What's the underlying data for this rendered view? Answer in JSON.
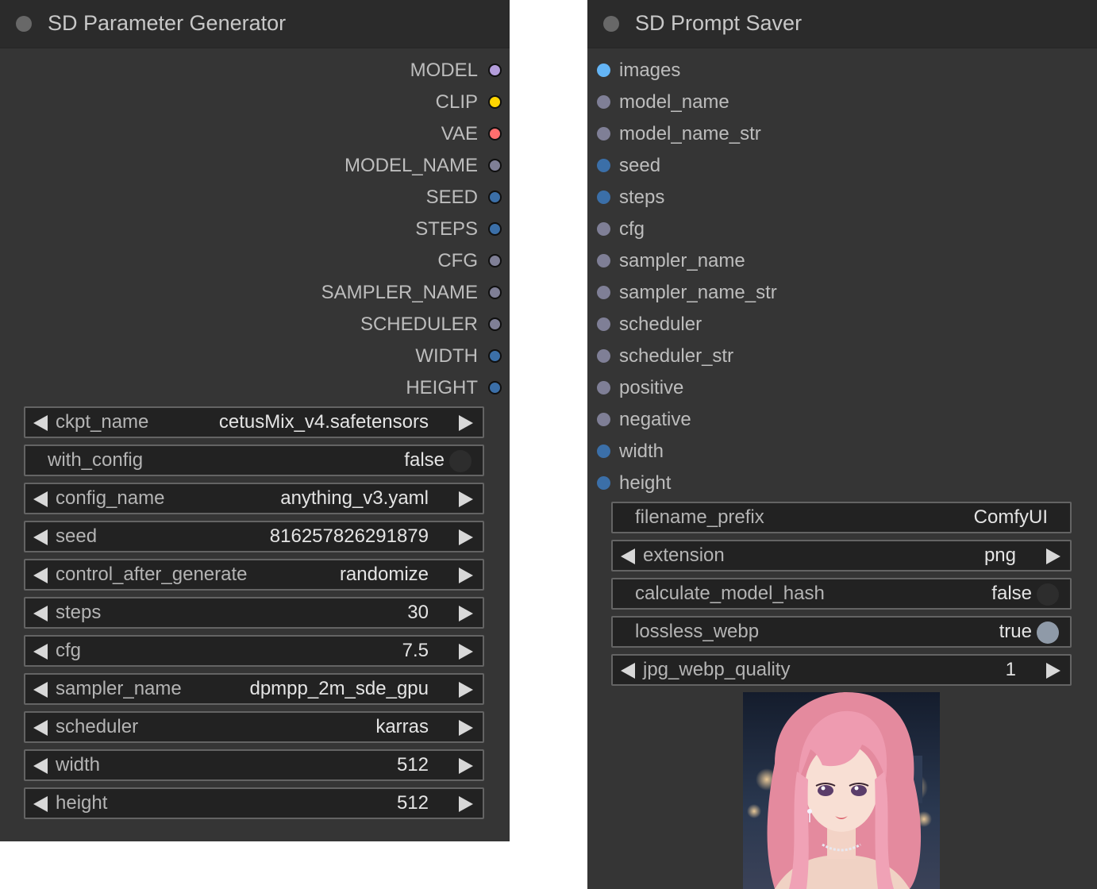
{
  "parameter_generator": {
    "title": "SD Parameter Generator",
    "outputs": [
      {
        "label": "MODEL",
        "color": "#b39ddb"
      },
      {
        "label": "CLIP",
        "color": "#ffd500"
      },
      {
        "label": "VAE",
        "color": "#ff6e6e"
      },
      {
        "label": "MODEL_NAME",
        "color": "#7f7f96"
      },
      {
        "label": "SEED",
        "color": "#3b6fa8"
      },
      {
        "label": "STEPS",
        "color": "#3b6fa8"
      },
      {
        "label": "CFG",
        "color": "#7f7f96"
      },
      {
        "label": "SAMPLER_NAME",
        "color": "#7f7f96"
      },
      {
        "label": "SCHEDULER",
        "color": "#7f7f96"
      },
      {
        "label": "WIDTH",
        "color": "#3b6fa8"
      },
      {
        "label": "HEIGHT",
        "color": "#3b6fa8"
      }
    ],
    "widgets": [
      {
        "label": "ckpt_name",
        "value": "cetusMix_v4.safetensors",
        "kind": "combo"
      },
      {
        "label": "with_config",
        "value": "false",
        "kind": "toggle",
        "state": false
      },
      {
        "label": "config_name",
        "value": "anything_v3.yaml",
        "kind": "combo"
      },
      {
        "label": "seed",
        "value": "816257826291879",
        "kind": "combo"
      },
      {
        "label": "control_after_generate",
        "value": "randomize",
        "kind": "combo"
      },
      {
        "label": "steps",
        "value": "30",
        "kind": "combo"
      },
      {
        "label": "cfg",
        "value": "7.5",
        "kind": "combo"
      },
      {
        "label": "sampler_name",
        "value": "dpmpp_2m_sde_gpu",
        "kind": "combo"
      },
      {
        "label": "scheduler",
        "value": "karras",
        "kind": "combo"
      },
      {
        "label": "width",
        "value": "512",
        "kind": "combo"
      },
      {
        "label": "height",
        "value": "512",
        "kind": "combo"
      }
    ]
  },
  "prompt_saver": {
    "title": "SD Prompt Saver",
    "inputs": [
      {
        "label": "images",
        "color": "#64b5f6"
      },
      {
        "label": "model_name",
        "color": "#7f7f96"
      },
      {
        "label": "model_name_str",
        "color": "#7f7f96"
      },
      {
        "label": "seed",
        "color": "#3b6fa8"
      },
      {
        "label": "steps",
        "color": "#3b6fa8"
      },
      {
        "label": "cfg",
        "color": "#7f7f96"
      },
      {
        "label": "sampler_name",
        "color": "#7f7f96"
      },
      {
        "label": "sampler_name_str",
        "color": "#7f7f96"
      },
      {
        "label": "scheduler",
        "color": "#7f7f96"
      },
      {
        "label": "scheduler_str",
        "color": "#7f7f96"
      },
      {
        "label": "positive",
        "color": "#7f7f96"
      },
      {
        "label": "negative",
        "color": "#7f7f96"
      },
      {
        "label": "width",
        "color": "#3b6fa8"
      },
      {
        "label": "height",
        "color": "#3b6fa8"
      }
    ],
    "widgets": [
      {
        "label": "filename_prefix",
        "value": "ComfyUI",
        "kind": "text"
      },
      {
        "label": "extension",
        "value": "png",
        "kind": "combo"
      },
      {
        "label": "calculate_model_hash",
        "value": "false",
        "kind": "toggle",
        "state": false
      },
      {
        "label": "lossless_webp",
        "value": "true",
        "kind": "toggle",
        "state": true
      },
      {
        "label": "jpg_webp_quality",
        "value": "1",
        "kind": "combo"
      }
    ],
    "preview_image": "anime-girl-pink-hair-portrait"
  }
}
